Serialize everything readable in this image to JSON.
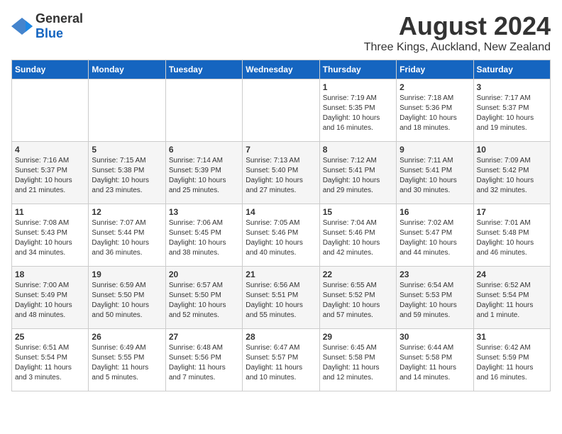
{
  "header": {
    "logo_general": "General",
    "logo_blue": "Blue",
    "title": "August 2024",
    "subtitle": "Three Kings, Auckland, New Zealand"
  },
  "weekdays": [
    "Sunday",
    "Monday",
    "Tuesday",
    "Wednesday",
    "Thursday",
    "Friday",
    "Saturday"
  ],
  "weeks": [
    [
      {
        "date": "",
        "info": ""
      },
      {
        "date": "",
        "info": ""
      },
      {
        "date": "",
        "info": ""
      },
      {
        "date": "",
        "info": ""
      },
      {
        "date": "1",
        "info": "Sunrise: 7:19 AM\nSunset: 5:35 PM\nDaylight: 10 hours\nand 16 minutes."
      },
      {
        "date": "2",
        "info": "Sunrise: 7:18 AM\nSunset: 5:36 PM\nDaylight: 10 hours\nand 18 minutes."
      },
      {
        "date": "3",
        "info": "Sunrise: 7:17 AM\nSunset: 5:37 PM\nDaylight: 10 hours\nand 19 minutes."
      }
    ],
    [
      {
        "date": "4",
        "info": "Sunrise: 7:16 AM\nSunset: 5:37 PM\nDaylight: 10 hours\nand 21 minutes."
      },
      {
        "date": "5",
        "info": "Sunrise: 7:15 AM\nSunset: 5:38 PM\nDaylight: 10 hours\nand 23 minutes."
      },
      {
        "date": "6",
        "info": "Sunrise: 7:14 AM\nSunset: 5:39 PM\nDaylight: 10 hours\nand 25 minutes."
      },
      {
        "date": "7",
        "info": "Sunrise: 7:13 AM\nSunset: 5:40 PM\nDaylight: 10 hours\nand 27 minutes."
      },
      {
        "date": "8",
        "info": "Sunrise: 7:12 AM\nSunset: 5:41 PM\nDaylight: 10 hours\nand 29 minutes."
      },
      {
        "date": "9",
        "info": "Sunrise: 7:11 AM\nSunset: 5:41 PM\nDaylight: 10 hours\nand 30 minutes."
      },
      {
        "date": "10",
        "info": "Sunrise: 7:09 AM\nSunset: 5:42 PM\nDaylight: 10 hours\nand 32 minutes."
      }
    ],
    [
      {
        "date": "11",
        "info": "Sunrise: 7:08 AM\nSunset: 5:43 PM\nDaylight: 10 hours\nand 34 minutes."
      },
      {
        "date": "12",
        "info": "Sunrise: 7:07 AM\nSunset: 5:44 PM\nDaylight: 10 hours\nand 36 minutes."
      },
      {
        "date": "13",
        "info": "Sunrise: 7:06 AM\nSunset: 5:45 PM\nDaylight: 10 hours\nand 38 minutes."
      },
      {
        "date": "14",
        "info": "Sunrise: 7:05 AM\nSunset: 5:46 PM\nDaylight: 10 hours\nand 40 minutes."
      },
      {
        "date": "15",
        "info": "Sunrise: 7:04 AM\nSunset: 5:46 PM\nDaylight: 10 hours\nand 42 minutes."
      },
      {
        "date": "16",
        "info": "Sunrise: 7:02 AM\nSunset: 5:47 PM\nDaylight: 10 hours\nand 44 minutes."
      },
      {
        "date": "17",
        "info": "Sunrise: 7:01 AM\nSunset: 5:48 PM\nDaylight: 10 hours\nand 46 minutes."
      }
    ],
    [
      {
        "date": "18",
        "info": "Sunrise: 7:00 AM\nSunset: 5:49 PM\nDaylight: 10 hours\nand 48 minutes."
      },
      {
        "date": "19",
        "info": "Sunrise: 6:59 AM\nSunset: 5:50 PM\nDaylight: 10 hours\nand 50 minutes."
      },
      {
        "date": "20",
        "info": "Sunrise: 6:57 AM\nSunset: 5:50 PM\nDaylight: 10 hours\nand 52 minutes."
      },
      {
        "date": "21",
        "info": "Sunrise: 6:56 AM\nSunset: 5:51 PM\nDaylight: 10 hours\nand 55 minutes."
      },
      {
        "date": "22",
        "info": "Sunrise: 6:55 AM\nSunset: 5:52 PM\nDaylight: 10 hours\nand 57 minutes."
      },
      {
        "date": "23",
        "info": "Sunrise: 6:54 AM\nSunset: 5:53 PM\nDaylight: 10 hours\nand 59 minutes."
      },
      {
        "date": "24",
        "info": "Sunrise: 6:52 AM\nSunset: 5:54 PM\nDaylight: 11 hours\nand 1 minute."
      }
    ],
    [
      {
        "date": "25",
        "info": "Sunrise: 6:51 AM\nSunset: 5:54 PM\nDaylight: 11 hours\nand 3 minutes."
      },
      {
        "date": "26",
        "info": "Sunrise: 6:49 AM\nSunset: 5:55 PM\nDaylight: 11 hours\nand 5 minutes."
      },
      {
        "date": "27",
        "info": "Sunrise: 6:48 AM\nSunset: 5:56 PM\nDaylight: 11 hours\nand 7 minutes."
      },
      {
        "date": "28",
        "info": "Sunrise: 6:47 AM\nSunset: 5:57 PM\nDaylight: 11 hours\nand 10 minutes."
      },
      {
        "date": "29",
        "info": "Sunrise: 6:45 AM\nSunset: 5:58 PM\nDaylight: 11 hours\nand 12 minutes."
      },
      {
        "date": "30",
        "info": "Sunrise: 6:44 AM\nSunset: 5:58 PM\nDaylight: 11 hours\nand 14 minutes."
      },
      {
        "date": "31",
        "info": "Sunrise: 6:42 AM\nSunset: 5:59 PM\nDaylight: 11 hours\nand 16 minutes."
      }
    ]
  ]
}
